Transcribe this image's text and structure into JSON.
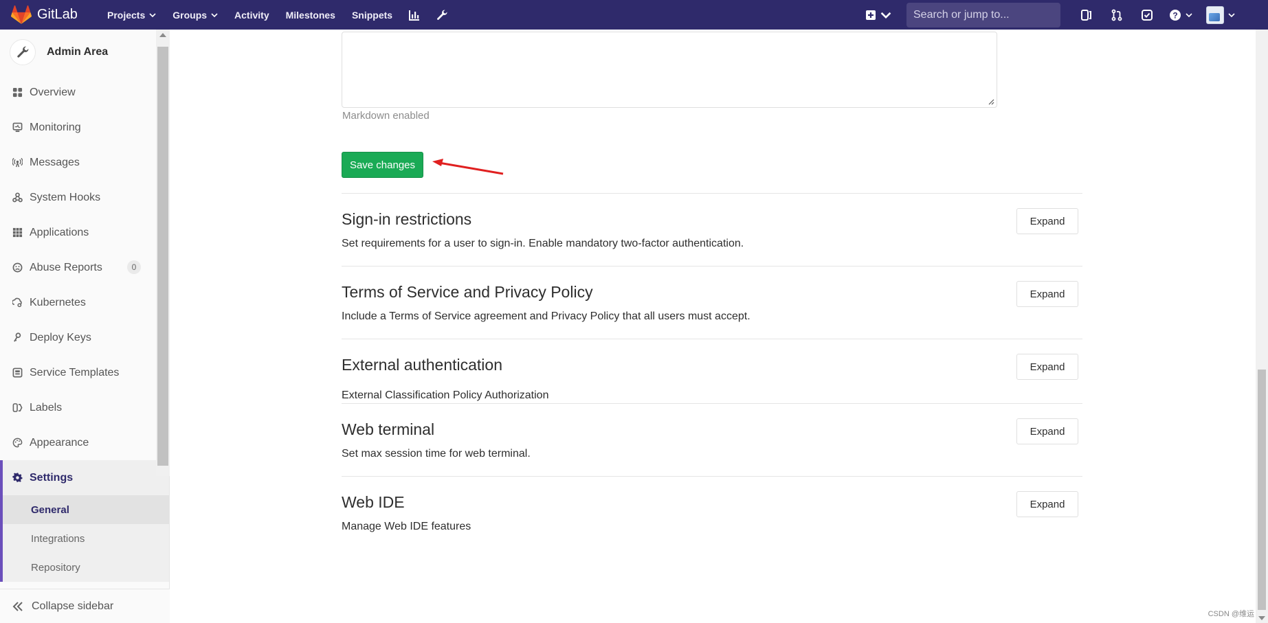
{
  "navbar": {
    "brand": "GitLab",
    "links": [
      {
        "label": "Projects",
        "has_caret": true
      },
      {
        "label": "Groups",
        "has_caret": true
      },
      {
        "label": "Activity",
        "has_caret": false
      },
      {
        "label": "Milestones",
        "has_caret": false
      },
      {
        "label": "Snippets",
        "has_caret": false
      }
    ],
    "extra_icons": [
      "chart-icon",
      "wrench-icon"
    ],
    "search_placeholder": "Search or jump to...",
    "right_icons": [
      "issues-icon",
      "merge-request-icon",
      "todo-icon",
      "help-icon"
    ]
  },
  "sidebar": {
    "title": "Admin Area",
    "items": [
      {
        "label": "Overview",
        "icon": "overview-icon"
      },
      {
        "label": "Monitoring",
        "icon": "monitor-icon"
      },
      {
        "label": "Messages",
        "icon": "broadcast-icon"
      },
      {
        "label": "System Hooks",
        "icon": "hook-icon"
      },
      {
        "label": "Applications",
        "icon": "applications-icon"
      },
      {
        "label": "Abuse Reports",
        "icon": "abuse-icon",
        "badge": "0"
      },
      {
        "label": "Kubernetes",
        "icon": "kubernetes-icon"
      },
      {
        "label": "Deploy Keys",
        "icon": "key-icon"
      },
      {
        "label": "Service Templates",
        "icon": "template-icon"
      },
      {
        "label": "Labels",
        "icon": "label-icon"
      },
      {
        "label": "Appearance",
        "icon": "palette-icon"
      },
      {
        "label": "Settings",
        "icon": "gear-icon",
        "active": true
      }
    ],
    "settings_sub": [
      {
        "label": "General",
        "active": true
      },
      {
        "label": "Integrations",
        "active": false
      },
      {
        "label": "Repository",
        "active": false
      }
    ],
    "collapse_label": "Collapse sidebar"
  },
  "main": {
    "textarea_hint": "Markdown enabled",
    "save_label": "Save changes",
    "expand_label": "Expand",
    "sections": [
      {
        "title": "Sign-in restrictions",
        "desc": "Set requirements for a user to sign-in. Enable mandatory two-factor authentication."
      },
      {
        "title": "Terms of Service and Privacy Policy",
        "desc": "Include a Terms of Service agreement and Privacy Policy that all users must accept."
      },
      {
        "title": "External authentication",
        "desc": "External Classification Policy Authorization"
      },
      {
        "title": "Web terminal",
        "desc": "Set max session time for web terminal."
      },
      {
        "title": "Web IDE",
        "desc": "Manage Web IDE features"
      }
    ]
  },
  "watermark": "CSDN @维运",
  "colors": {
    "navbar": "#2f2a6b",
    "primary_button": "#1aaa55",
    "sidebar_active_border": "#6b4fbb",
    "annotation_arrow": "#e02020"
  }
}
